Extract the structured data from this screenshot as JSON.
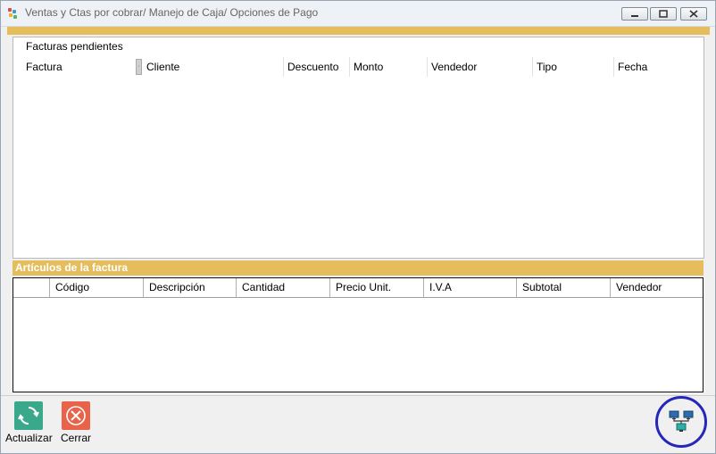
{
  "window": {
    "title": "Ventas y Ctas por cobrar/ Manejo de Caja/ Opciones de Pago",
    "controls": [
      "minimize",
      "maximize",
      "close"
    ]
  },
  "pending_invoices": {
    "title": "Facturas pendientes",
    "columns": [
      "Factura",
      "Cliente",
      "Descuento",
      "Monto",
      "Vendedor",
      "Tipo",
      "Fecha"
    ],
    "rows": []
  },
  "invoice_items": {
    "title": "Artículos de la factura",
    "columns": [
      "",
      "Código",
      "Descripción",
      "Cantidad",
      "Precio Unit.",
      "I.V.A",
      "Subtotal",
      "Vendedor"
    ],
    "rows": []
  },
  "toolbar": {
    "refresh_label": "Actualizar",
    "close_label": "Cerrar",
    "network_icon": "network-status-icon"
  },
  "colors": {
    "accent": "#e6bd5c",
    "refresh": "#3aa88a",
    "close": "#e8634a",
    "highlight_circle": "#2626b9"
  }
}
